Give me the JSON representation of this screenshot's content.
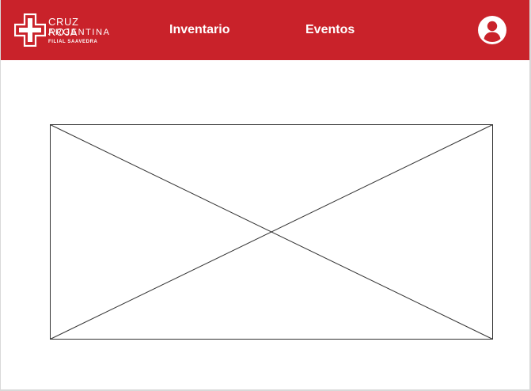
{
  "brand": {
    "line1": "CRUZ ROJA",
    "line2": "ARGENTINA",
    "line3": "FILIAL SAAVEDRA",
    "color": "#c9222a"
  },
  "nav": {
    "items": [
      {
        "label": "Inventario"
      },
      {
        "label": "Eventos"
      }
    ]
  },
  "user": {
    "icon": "account-circle-icon"
  },
  "main": {
    "media_placeholder": "image-placeholder"
  }
}
